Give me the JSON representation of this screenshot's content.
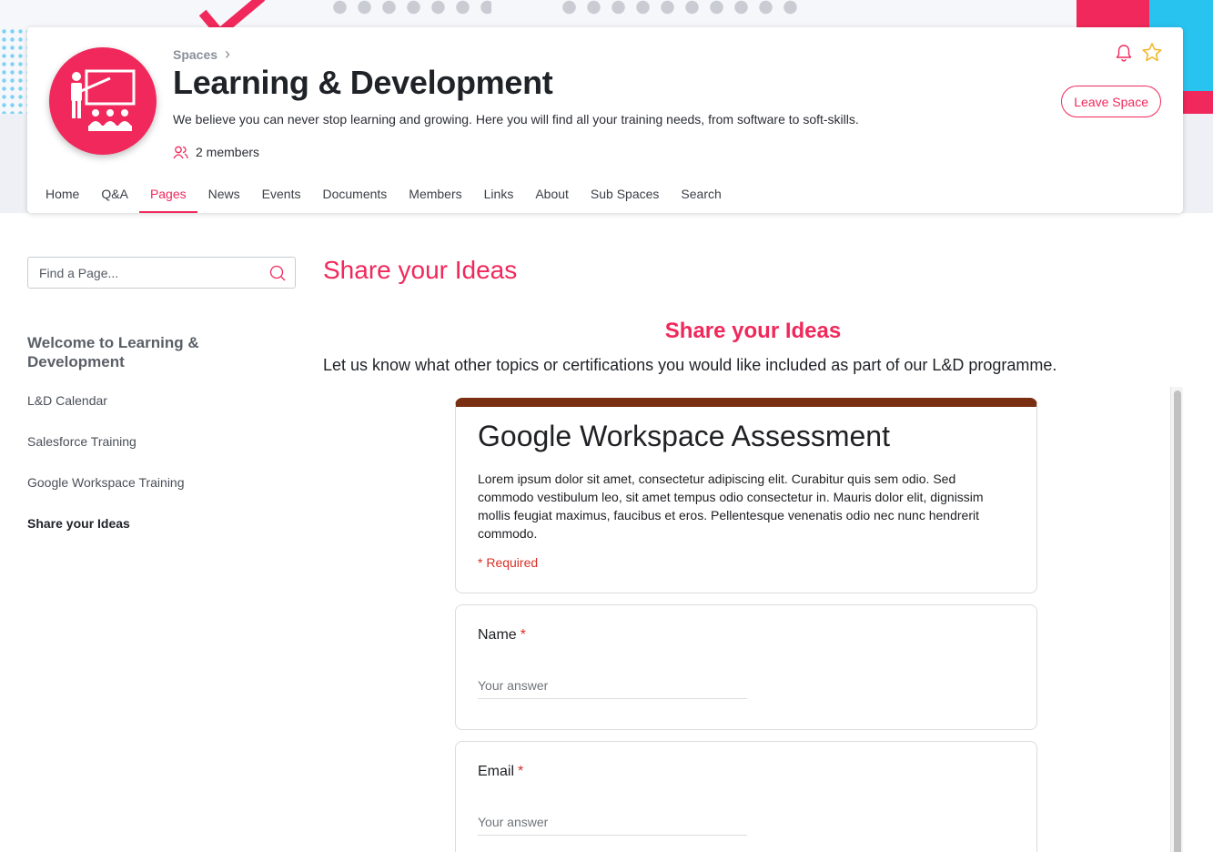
{
  "header": {
    "breadcrumb": "Spaces",
    "title": "Learning & Development",
    "description": "We believe you can never stop learning and growing. Here you will find all your training needs, from software to soft-skills.",
    "members": "2 members",
    "leave_label": "Leave Space",
    "tabs": [
      {
        "label": "Home",
        "active": false
      },
      {
        "label": "Q&A",
        "active": false
      },
      {
        "label": "Pages",
        "active": true
      },
      {
        "label": "News",
        "active": false
      },
      {
        "label": "Events",
        "active": false
      },
      {
        "label": "Documents",
        "active": false
      },
      {
        "label": "Members",
        "active": false
      },
      {
        "label": "Links",
        "active": false
      },
      {
        "label": "About",
        "active": false
      },
      {
        "label": "Sub Spaces",
        "active": false
      },
      {
        "label": "Search",
        "active": false
      }
    ]
  },
  "sidebar": {
    "search_placeholder": "Find a Page...",
    "heading": "Welcome to Learning & Development",
    "items": [
      {
        "label": "L&D Calendar"
      },
      {
        "label": "Salesforce Training"
      },
      {
        "label": "Google Workspace Training"
      },
      {
        "label": "Share your Ideas"
      }
    ]
  },
  "main": {
    "page_title": "Share your Ideas",
    "section_heading": "Share your Ideas",
    "intro": "Let us know what other topics or certifications you would like included as part of our L&D programme."
  },
  "form": {
    "title": "Google Workspace Assessment",
    "description": "Lorem ipsum dolor sit amet, consectetur adipiscing elit. Curabitur quis sem odio. Sed commodo vestibulum leo, sit amet tempus odio consectetur in. Mauris dolor elit, dignissim mollis feugiat maximus, faucibus et eros. Pellentesque venenatis odio nec nunc hendrerit commodo.",
    "required_note": "* Required",
    "questions": [
      {
        "label": "Name",
        "star": "*",
        "placeholder": "Your answer"
      },
      {
        "label": "Email",
        "star": "*",
        "placeholder": "Your answer"
      }
    ]
  },
  "colors": {
    "accent": "#f0285b",
    "form_header": "#7a2e12",
    "required": "#d93025"
  },
  "icons": [
    "presentation-teacher-icon",
    "chevron-right-icon",
    "members-icon",
    "bell-icon",
    "star-icon",
    "search-icon"
  ]
}
